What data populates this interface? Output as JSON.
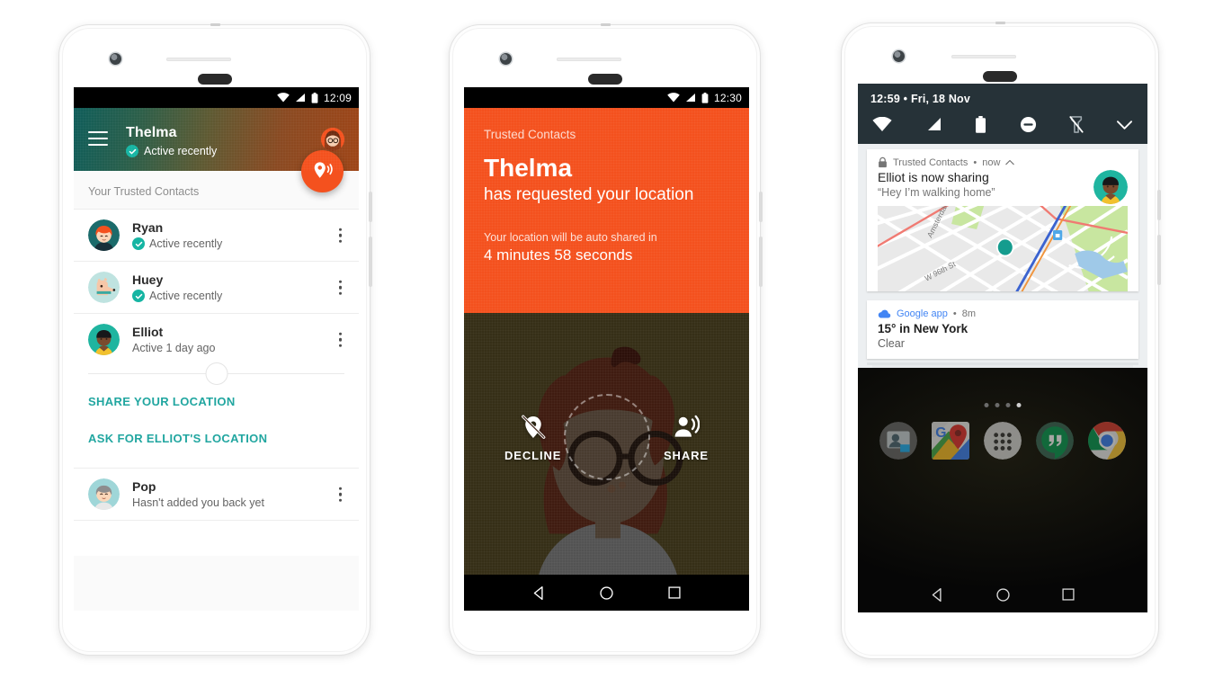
{
  "phone1": {
    "status_bar": {
      "time": "12:09",
      "icons": [
        "wifi-icon",
        "signal-icon",
        "battery-icon"
      ]
    },
    "header": {
      "menu_icon": "hamburger-menu-icon",
      "title": "Thelma",
      "status": "Active recently",
      "avatar": "thelma-avatar",
      "fab_icon": "share-location-icon"
    },
    "section_label": "Your Trusted Contacts",
    "contacts": [
      {
        "name": "Ryan",
        "status": "Active recently",
        "verified": true,
        "avatar": "ryan-avatar"
      },
      {
        "name": "Huey",
        "status": "Active recently",
        "verified": true,
        "avatar": "huey-avatar"
      },
      {
        "name": "Elliot",
        "status": "Active 1 day ago",
        "verified": false,
        "avatar": "elliot-avatar"
      },
      {
        "name": "Pop",
        "status": "Hasn't added you back yet",
        "verified": false,
        "avatar": "pop-avatar"
      }
    ],
    "expanded_actions": [
      "SHARE YOUR LOCATION",
      "ASK FOR ELLIOT'S LOCATION"
    ]
  },
  "phone2": {
    "status_bar": {
      "time": "12:30",
      "icons": [
        "wifi-icon",
        "signal-icon",
        "battery-icon"
      ]
    },
    "app_name": "Trusted Contacts",
    "requester": "Thelma",
    "request_line": "has requested your location",
    "auto_share_note": "Your location will be auto shared in",
    "countdown": "4 minutes 58 seconds",
    "actions": [
      {
        "label": "DECLINE",
        "icon": "location-off-icon"
      },
      {
        "label": "SHARE",
        "icon": "share-location-person-icon"
      }
    ],
    "nav": [
      "back-icon",
      "home-icon",
      "recents-icon"
    ]
  },
  "phone3": {
    "quick_settings": {
      "time": "12:59",
      "separator": "•",
      "date": "Fri, 18 Nov",
      "icons": [
        "wifi-icon",
        "signal-icon",
        "battery-icon",
        "do-not-disturb-icon",
        "flashlight-off-icon",
        "chevron-down-icon"
      ]
    },
    "notifications": [
      {
        "app": "Trusted Contacts",
        "dot": "•",
        "time": "now",
        "collapse_icon": "chevron-up-icon",
        "lock_icon": "lock-icon",
        "title": "Elliot is now sharing",
        "text": "“Hey I’m walking home”",
        "avatar": "elliot-avatar",
        "map": {
          "street_1": "Amsterdam A",
          "street_2": "W 96th St",
          "marker": "location-dot"
        }
      },
      {
        "app": "Google app",
        "dot": "•",
        "time": "8m",
        "icon": "google-cloud-icon",
        "title": "15° in New York",
        "text": "Clear"
      }
    ],
    "home": {
      "page_dots": 4,
      "active_dot": 4,
      "dock": [
        "contacts-app-icon",
        "google-maps-icon",
        "all-apps-icon",
        "hangouts-icon",
        "chrome-icon"
      ]
    },
    "nav": [
      "back-icon",
      "home-icon",
      "recents-icon"
    ]
  },
  "colors": {
    "accent_orange": "#f4511e",
    "accent_teal": "#21a6a0",
    "verified_teal": "#16b5a3",
    "quick_settings_bg": "#263238",
    "google_blue": "#4285f4"
  }
}
